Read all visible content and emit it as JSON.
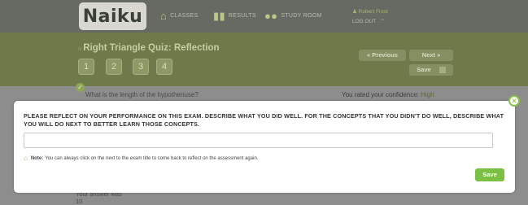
{
  "app": {
    "logo": "Naiku"
  },
  "nav": {
    "classes": "CLASSES",
    "results": "RESULTS",
    "study_room": "STUDY ROOM"
  },
  "user": {
    "name": "Robert Frost",
    "logout": "LOG OUT"
  },
  "quiz": {
    "title": "Right Triangle Quiz: Reflection",
    "question_numbers": [
      "1",
      "2",
      "3",
      "4"
    ],
    "previous_label": "Previous",
    "next_label": "Next",
    "save_label": "Save"
  },
  "question": {
    "text": "What is the length of the hypothenuse?",
    "confidence_label": "You rated your confidence:",
    "confidence_value": "High",
    "answer_label": "Your answer was",
    "answer_value": "10"
  },
  "modal": {
    "prompt": "PLEASE REFLECT ON YOUR PERFORMANCE ON THIS EXAM. DESCRIBE WHAT YOU DID WELL. FOR THE CONCEPTS THAT YOU DIDN'T DO WELL, DESCRIBE WHAT YOU WILL DO NEXT TO BETTER LEARN THOSE CONCEPTS.",
    "input_value": "",
    "note_label": "Note:",
    "note_text": "You can always click on the next to the exam title to come back to reflect on the assessment again.",
    "save_label": "Save"
  },
  "colors": {
    "accent": "#7bc043",
    "topbar": "#666a62",
    "quizbar": "#6e7a49"
  }
}
